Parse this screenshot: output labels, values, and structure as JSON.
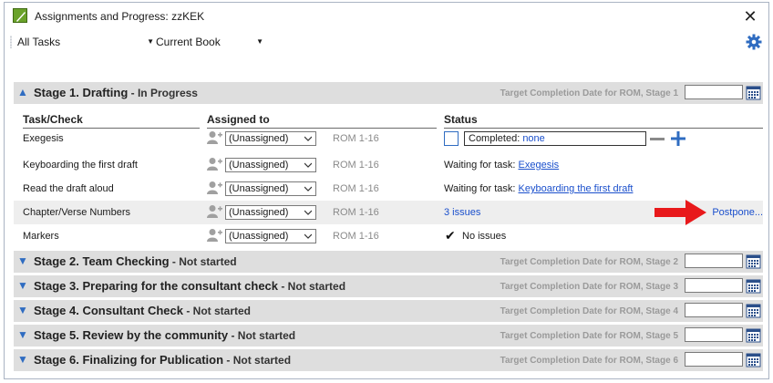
{
  "window": {
    "title": "Assignments and Progress: zzKEK",
    "close_glyph": "✕"
  },
  "toolbar": {
    "filter_value": "All Tasks",
    "scope_value": "Current Book",
    "dropdown_glyph": "▼",
    "settings_icon": "gear-icon"
  },
  "stage1": {
    "title": "Stage 1. Drafting",
    "status": " - In Progress",
    "target_label": "Target Completion Date for ROM, Stage 1",
    "date_value": "",
    "columns": {
      "task": "Task/Check",
      "assigned": "Assigned to",
      "status": "Status"
    },
    "rows": [
      {
        "task": "Exegesis",
        "assignee": "(Unassigned)",
        "range": "ROM 1-16",
        "completed_label": "Completed: ",
        "completed_value": "none",
        "minus_glyph": "—",
        "plus_glyph": "+"
      },
      {
        "task": "Keyboarding the first draft",
        "assignee": "(Unassigned)",
        "range": "ROM 1-16",
        "status_prefix": "Waiting for task: ",
        "status_link": "Exegesis"
      },
      {
        "task": "Read the draft aloud",
        "assignee": "(Unassigned)",
        "range": "ROM 1-16",
        "status_prefix": "Waiting for task: ",
        "status_link": "Keyboarding the first draft"
      },
      {
        "task": "Chapter/Verse Numbers",
        "assignee": "(Unassigned)",
        "range": "ROM 1-16",
        "issues_link": "3 issues",
        "postpone_link": "Postpone..."
      },
      {
        "task": "Markers",
        "assignee": "(Unassigned)",
        "range": "ROM 1-16",
        "check_glyph": "✔",
        "status_text": "No issues"
      }
    ]
  },
  "stages": [
    {
      "title": "Stage 2. Team Checking",
      "status": " - Not started",
      "target_label": "Target Completion Date for ROM, Stage 2",
      "date_value": ""
    },
    {
      "title": "Stage 3. Preparing for the consultant check",
      "status": " - Not started",
      "target_label": "Target Completion Date for ROM, Stage 3",
      "date_value": ""
    },
    {
      "title": "Stage 4. Consultant Check",
      "status": " - Not started",
      "target_label": "Target Completion Date for ROM, Stage 4",
      "date_value": ""
    },
    {
      "title": "Stage 5. Review by the community",
      "status": " - Not started",
      "target_label": "Target Completion Date for ROM, Stage 5",
      "date_value": ""
    },
    {
      "title": "Stage 6. Finalizing for Publication",
      "status": " - Not started",
      "target_label": "Target Completion Date for ROM, Stage 6",
      "date_value": ""
    }
  ],
  "icons": {
    "expanded_chevron": "▲",
    "collapsed_chevron": "▼"
  },
  "colors": {
    "accent": "#2f6cc1",
    "link": "#1a4fcc",
    "header_bg": "#dedede",
    "arrow": "#e8191b"
  }
}
